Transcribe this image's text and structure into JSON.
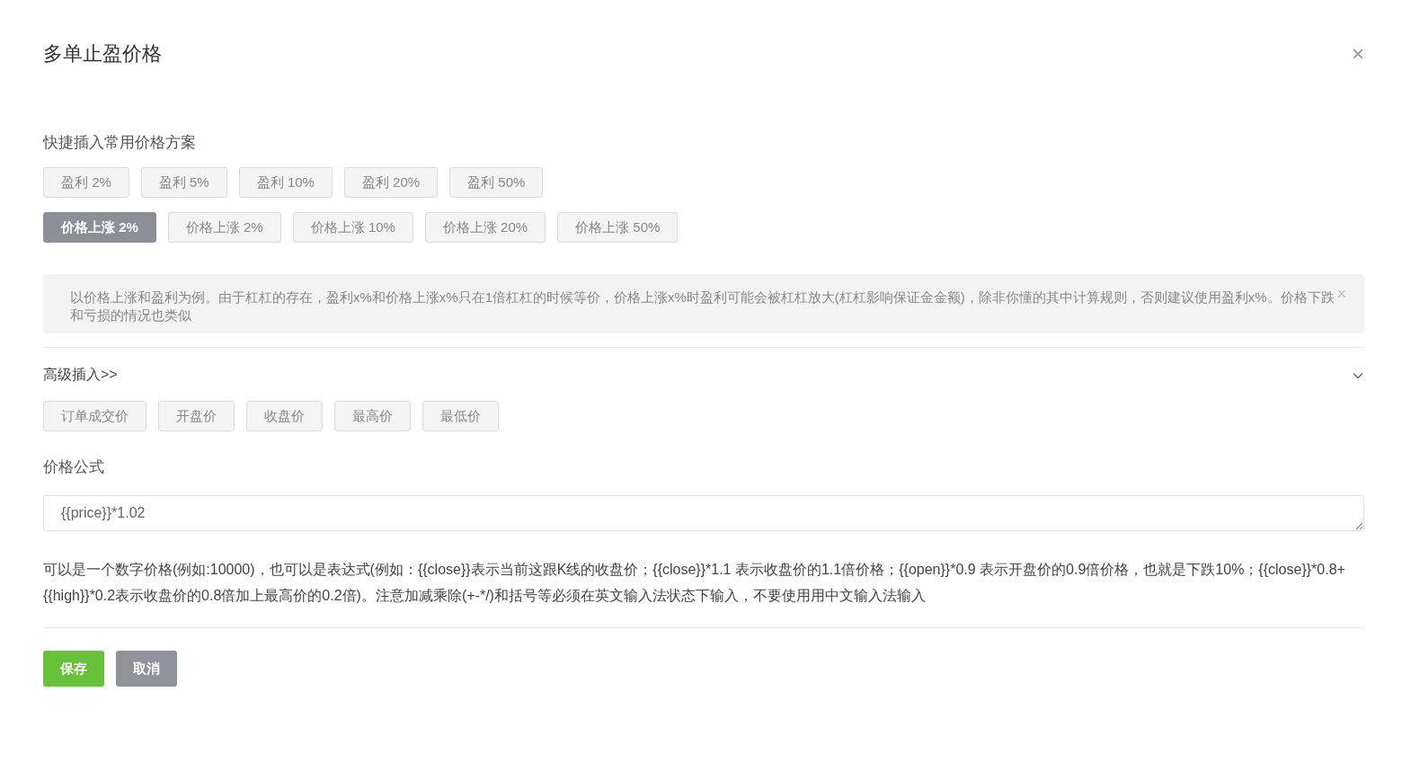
{
  "dialog": {
    "title": "多单止盈价格",
    "close": "×"
  },
  "presets": {
    "label": "快捷插入常用价格方案",
    "profit_buttons": [
      {
        "label": "盈利 2%",
        "selected": false
      },
      {
        "label": "盈利 5%",
        "selected": false
      },
      {
        "label": "盈利 10%",
        "selected": false
      },
      {
        "label": "盈利 20%",
        "selected": false
      },
      {
        "label": "盈利 50%",
        "selected": false
      }
    ],
    "price_rise_buttons": [
      {
        "label": "价格上涨 2%",
        "selected": true
      },
      {
        "label": "价格上涨 2%",
        "selected": false
      },
      {
        "label": "价格上涨 10%",
        "selected": false
      },
      {
        "label": "价格上涨 20%",
        "selected": false
      },
      {
        "label": "价格上涨 50%",
        "selected": false
      }
    ]
  },
  "alert": {
    "text": "以价格上涨和盈利为例。由于杠杠的存在，盈利x%和价格上涨x%只在1倍杠杠的时候等价，价格上涨x%时盈利可能会被杠杠放大(杠杠影响保证金金额)，除非你懂的其中计算规则，否则建议使用盈利x%。价格下跌和亏损的情况也类似",
    "close": "×"
  },
  "advanced": {
    "label": "高级插入>>",
    "expanded": true,
    "buttons": [
      "订单成交价",
      "开盘价",
      "收盘价",
      "最高价",
      "最低价"
    ]
  },
  "formula": {
    "label": "价格公式",
    "value": "{{price}}*1.02",
    "help": "可以是一个数字价格(例如:10000)，也可以是表达式(例如：{{close}}表示当前这跟K线的收盘价；{{close}}*1.1 表示收盘价的1.1倍价格；{{open}}*0.9 表示开盘价的0.9倍价格，也就是下跌10%；{{close}}*0.8+{{high}}*0.2表示收盘价的0.8倍加上最高价的0.2倍)。注意加减乘除(+-*/)和括号等必须在英文输入法状态下输入，不要使用用中文输入法输入"
  },
  "footer": [
    {
      "label": "保存",
      "kind": "primary"
    },
    {
      "label": "取消",
      "kind": "secondary"
    }
  ]
}
